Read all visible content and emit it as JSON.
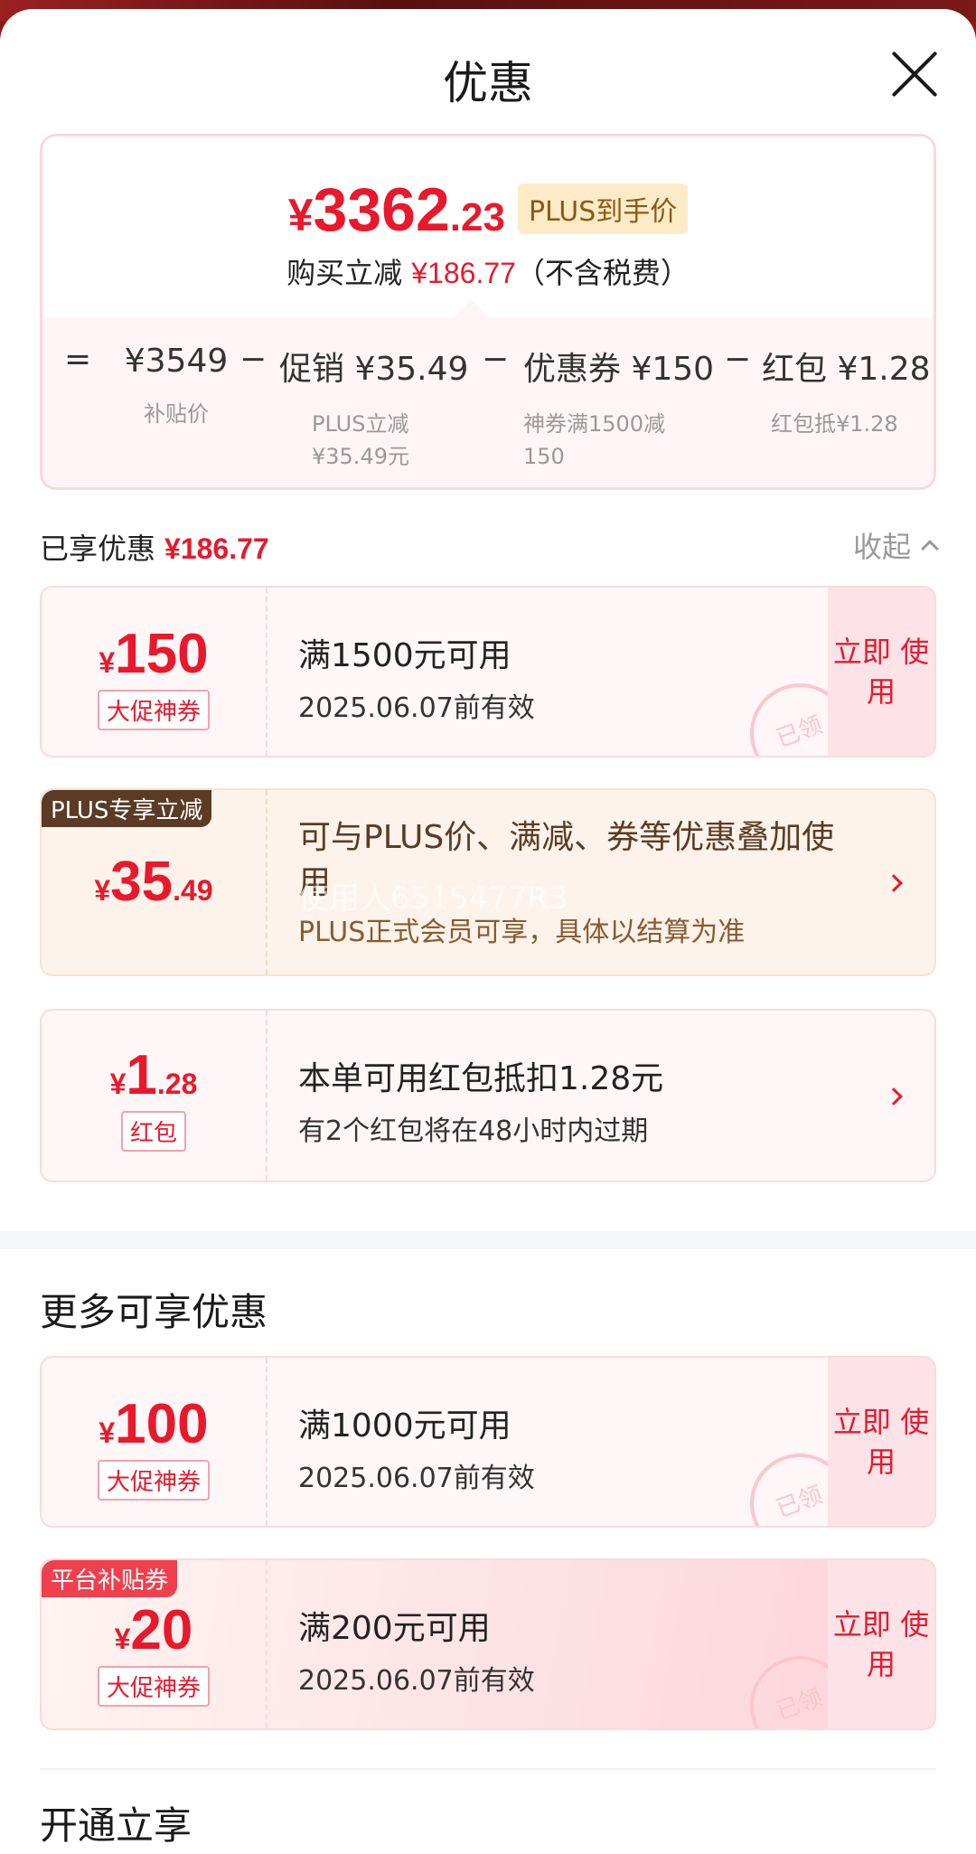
{
  "header": {
    "title": "优惠"
  },
  "summary": {
    "price_yen": "¥",
    "price_int": "3362",
    "price_dec": ".23",
    "price_tag": "PLUS到手价",
    "reduce_prefix": "购买立减",
    "reduce_amount": "¥186.77",
    "reduce_suffix": "（不含税费）",
    "calc": [
      {
        "op": "=",
        "value": "¥3549",
        "sub": "补贴价"
      },
      {
        "op": "−",
        "value": "促销 ¥35.49",
        "sub": "PLUS立减 ¥35.49元"
      },
      {
        "op": "−",
        "value": "优惠券 ¥150",
        "sub": "神券满1500减 150"
      },
      {
        "op": "−",
        "value": "红包 ¥1.28",
        "sub": "红包抵¥1.28"
      }
    ]
  },
  "enjoyed": {
    "label": "已享优惠",
    "amount": "¥186.77",
    "collapse": "收起"
  },
  "applied": [
    {
      "yen": "¥",
      "big": "150",
      "small": "",
      "badge": "大促神券",
      "title": "满1500元可用",
      "sub": "2025.06.07前有效",
      "button": "立即 使用",
      "stamp": "已领"
    },
    {
      "corner": "PLUS专享立减",
      "yen": "¥",
      "big": "35",
      "small": ".49",
      "title": "可与PLUS价、满减、券等优惠叠加使用",
      "sub": "PLUS正式会员可享，具体以结算为准"
    },
    {
      "yen": "¥",
      "big": "1",
      "small": ".28",
      "badge": "红包",
      "title": "本单可用红包抵扣1.28元",
      "sub": "有2个红包将在48小时内过期"
    }
  ],
  "watermark": "使用人6515477R3",
  "more": {
    "title": "更多可享优惠",
    "items": [
      {
        "yen": "¥",
        "big": "100",
        "badge": "大促神券",
        "title": "满1000元可用",
        "sub": "2025.06.07前有效",
        "button": "立即 使用",
        "stamp": "已领"
      },
      {
        "corner": "平台补贴券",
        "yen": "¥",
        "big": "20",
        "badge": "大促神券",
        "title": "满200元可用",
        "sub": "2025.06.07前有效",
        "button": "立即 使用",
        "stamp": "已领"
      }
    ]
  },
  "open": {
    "title": "开通立享"
  }
}
